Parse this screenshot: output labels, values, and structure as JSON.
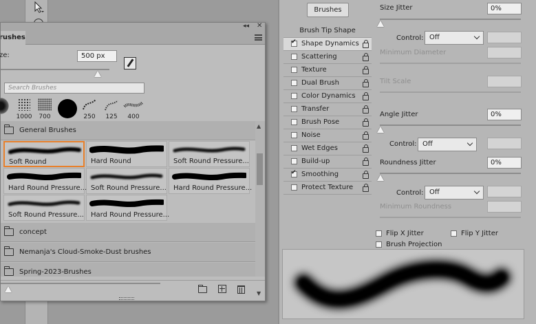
{
  "brushes_panel": {
    "tab_label": "rushes",
    "size_label": "ze:",
    "size_value": "500 px",
    "size_fraction": 0.89,
    "search_placeholder": "Search Brushes",
    "preset_sizes": [
      "1000",
      "700",
      "",
      "250",
      "125",
      "400"
    ],
    "groups": [
      {
        "label": "General Brushes",
        "expanded": true
      },
      {
        "label": "concept"
      },
      {
        "label": "Nemanja's Cloud-Smoke-Dust brushes"
      },
      {
        "label": "Spring-2023-Brushes"
      }
    ],
    "brushes": [
      {
        "name": "Soft Round",
        "selected": true,
        "soft": true
      },
      {
        "name": "Hard Round",
        "soft": false
      },
      {
        "name": "Soft Round Pressure...",
        "soft": true
      },
      {
        "name": "Hard Round Pressure...",
        "soft": false
      },
      {
        "name": "Soft Round Pressure...",
        "soft": true
      },
      {
        "name": "Hard Round Pressure...",
        "soft": false
      },
      {
        "name": "Soft Round Pressure...",
        "soft": true
      },
      {
        "name": "Hard Round Pressure...",
        "soft": false
      }
    ]
  },
  "settings_panel": {
    "brushes_button": "Brushes",
    "tip_header": "Brush Tip Shape",
    "options": [
      {
        "label": "Shape Dynamics",
        "checked": true,
        "active": true
      },
      {
        "label": "Scattering",
        "checked": false
      },
      {
        "label": "Texture",
        "checked": false
      },
      {
        "label": "Dual Brush",
        "checked": false
      },
      {
        "label": "Color Dynamics",
        "checked": false
      },
      {
        "label": "Transfer",
        "checked": false
      },
      {
        "label": "Brush Pose",
        "checked": false
      },
      {
        "label": "Noise",
        "checked": false
      },
      {
        "label": "Wet Edges",
        "checked": false
      },
      {
        "label": "Build-up",
        "checked": false
      },
      {
        "label": "Smoothing",
        "checked": true
      },
      {
        "label": "Protect Texture",
        "checked": false
      }
    ],
    "size_jitter": {
      "label": "Size Jitter",
      "value": "0%"
    },
    "control_label": "Control:",
    "control_value": "Off",
    "min_diameter": "Minimum Diameter",
    "tilt_scale": "Tilt Scale",
    "angle_jitter": {
      "label": "Angle Jitter",
      "value": "0%"
    },
    "roundness_jitter": {
      "label": "Roundness Jitter",
      "value": "0%"
    },
    "min_roundness": "Minimum Roundness",
    "flip_x": "Flip X Jitter",
    "flip_y": "Flip Y Jitter",
    "brush_projection": "Brush Projection"
  }
}
